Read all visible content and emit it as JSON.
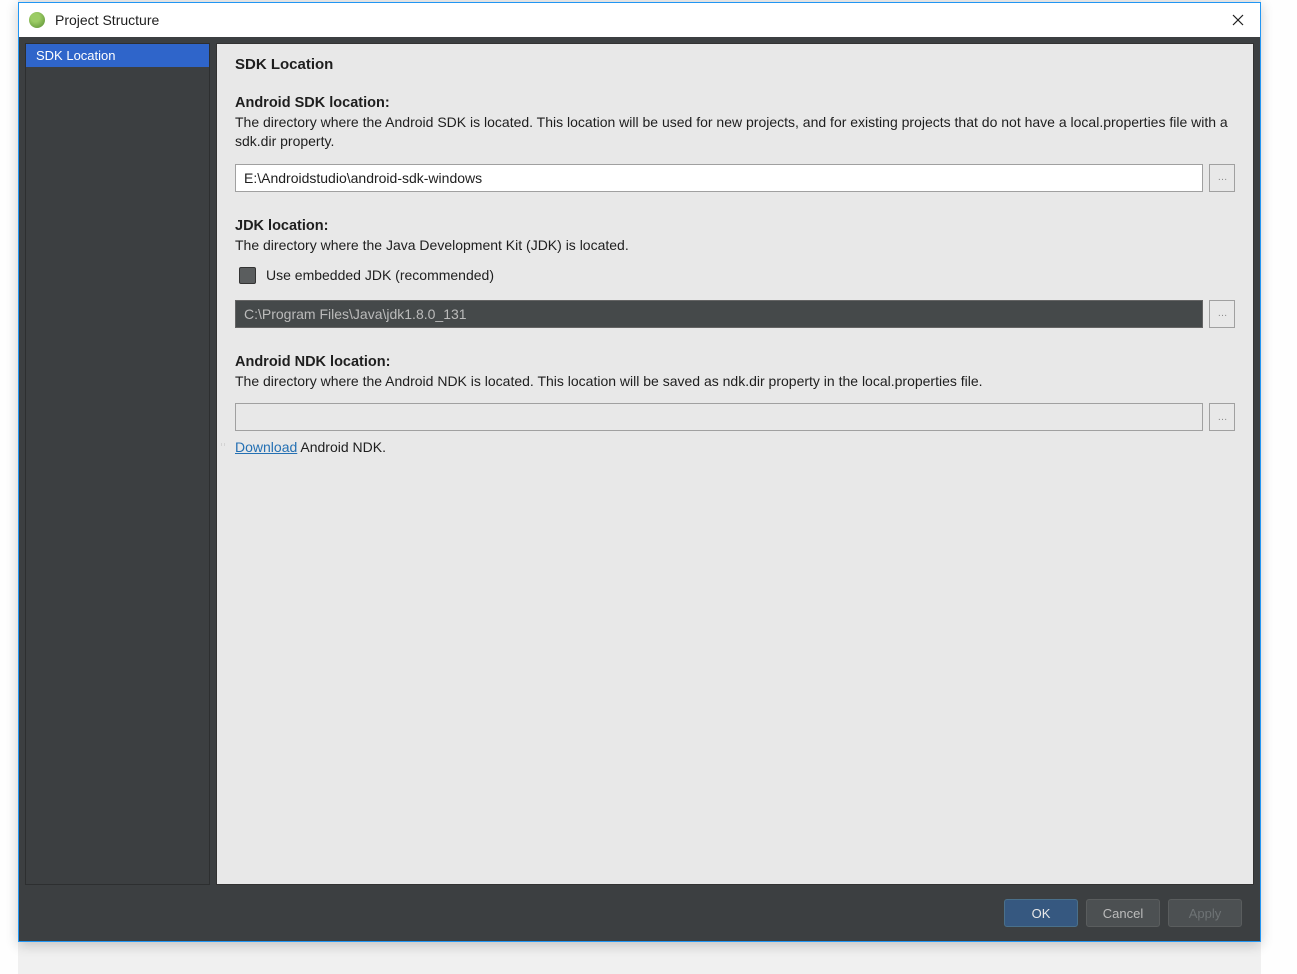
{
  "dialog": {
    "title": "Project Structure"
  },
  "sidebar": {
    "items": [
      {
        "label": "SDK Location",
        "selected": true
      }
    ]
  },
  "panel": {
    "heading": "SDK Location",
    "sdk": {
      "title": "Android SDK location:",
      "desc": "The directory where the Android SDK is located. This location will be used for new projects, and for existing projects that do not have a local.properties file with a sdk.dir property.",
      "value": "E:\\Androidstudio\\android-sdk-windows"
    },
    "jdk": {
      "title": "JDK location:",
      "desc": "The directory where the Java Development Kit (JDK) is located.",
      "checkbox_label": "Use embedded JDK (recommended)",
      "value": "C:\\Program Files\\Java\\jdk1.8.0_131"
    },
    "ndk": {
      "title": "Android NDK location:",
      "desc": "The directory where the Android NDK is located. This location will be saved as ndk.dir property in the local.properties file.",
      "value": "",
      "download_link": "Download",
      "download_tail": " Android NDK."
    }
  },
  "buttons": {
    "ok": "OK",
    "cancel": "Cancel",
    "apply": "Apply"
  },
  "browse_label": "…"
}
